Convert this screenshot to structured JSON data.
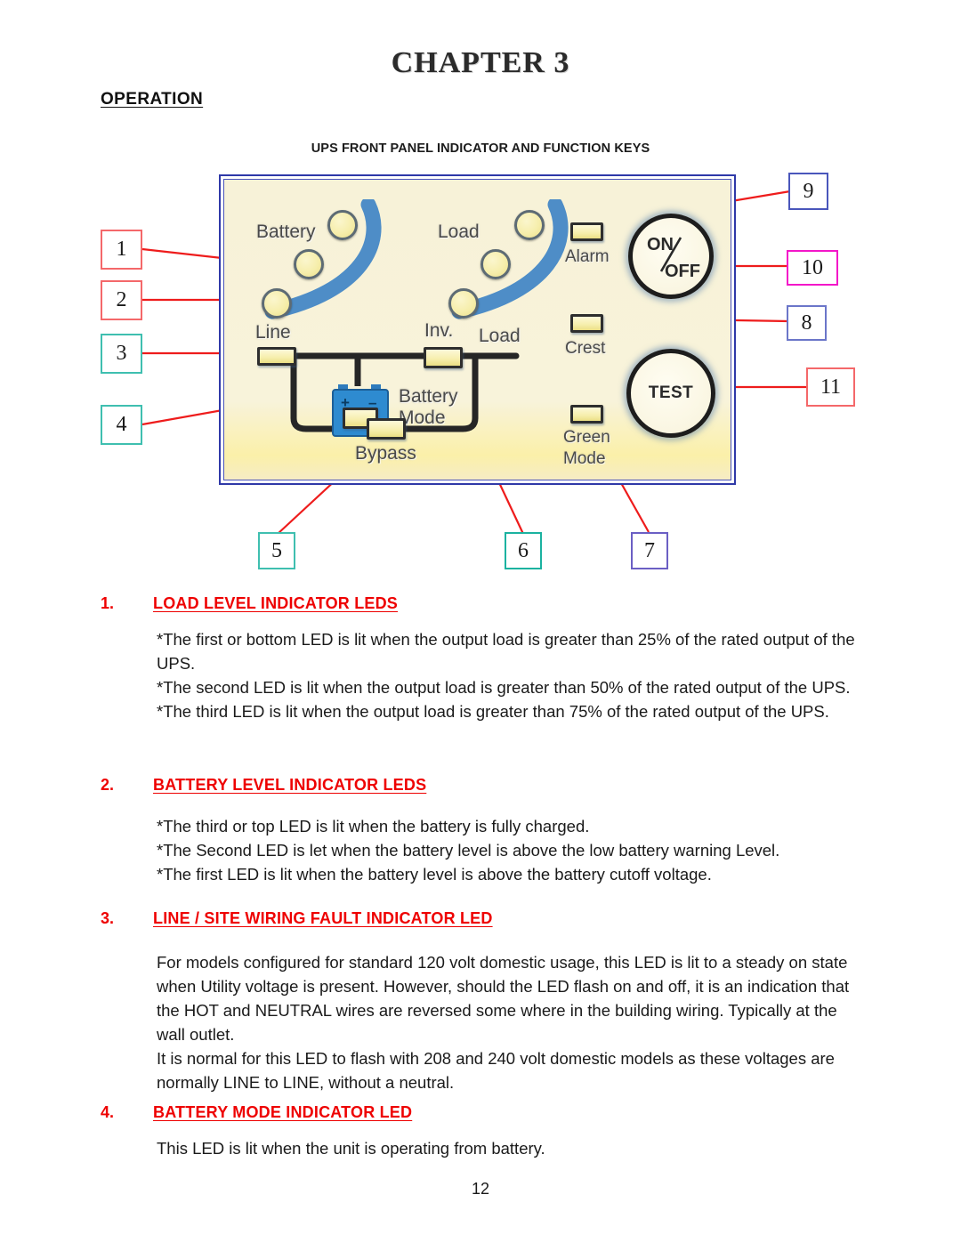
{
  "header": {
    "chapter_title": "CHAPTER 3",
    "operation_heading": "OPERATION",
    "figure_caption": "UPS FRONT PANEL INDICATOR AND FUNCTION KEYS"
  },
  "panel": {
    "labels": {
      "battery": "Battery",
      "load_top": "Load",
      "alarm": "Alarm",
      "crest": "Crest",
      "green_mode_1": "Green",
      "green_mode_2": "Mode",
      "line": "Line",
      "inv": "Inv.",
      "load_right": "Load",
      "battery_mode_1": "Battery",
      "battery_mode_2": "Mode",
      "bypass": "Bypass"
    },
    "buttons": {
      "on_off_top": "ON",
      "on_off_bottom": "OFF",
      "test": "TEST"
    },
    "battery_symbol": {
      "plus": "+",
      "minus": "–"
    }
  },
  "callouts": [
    {
      "id": "1",
      "label": "1",
      "color": "#f4686a"
    },
    {
      "id": "2",
      "label": "2",
      "color": "#f4686a"
    },
    {
      "id": "3",
      "label": "3",
      "color": "#3fbfb0"
    },
    {
      "id": "4",
      "label": "4",
      "color": "#3fbfb0"
    },
    {
      "id": "5",
      "label": "5",
      "color": "#3fbfb0"
    },
    {
      "id": "6",
      "label": "6",
      "color": "#1bb2a0"
    },
    {
      "id": "7",
      "label": "7",
      "color": "#6b5fc4"
    },
    {
      "id": "8",
      "label": "8",
      "color": "#6b76c9"
    },
    {
      "id": "9",
      "label": "9",
      "color": "#4a56bb"
    },
    {
      "id": "10",
      "label": "10",
      "color": "#f317c9"
    },
    {
      "id": "11",
      "label": "11",
      "color": "#f4686a"
    }
  ],
  "sections": [
    {
      "number": "1.",
      "title": "LOAD LEVEL INDICATOR LEDS",
      "body": "*The first or bottom LED is lit when the output load is greater than 25% of the rated output of the UPS.\n*The second LED is lit when the output load is greater than 50% of the rated output of the UPS.\n*The third LED is lit when the output load is greater than 75% of the rated output of the UPS."
    },
    {
      "number": "2.",
      "title": "BATTERY LEVEL INDICATOR LEDS",
      "body": "*The third or top LED is lit when the battery is fully charged.\n*The Second LED is let when the battery level is above the low battery warning Level.\n*The first LED is lit when the battery level is above the battery cutoff voltage."
    },
    {
      "number": "3.",
      "title": "LINE / SITE WIRING FAULT INDICATOR LED",
      "body": "For models configured for standard 120 volt domestic usage, this LED is lit to a steady on state when Utility voltage is present. However, should the LED flash on and off, it is an indication that the HOT and NEUTRAL wires are reversed some where in the building wiring. Typically at the wall outlet.\nIt is normal for this LED to flash with 208 and 240 volt domestic models as these voltages are normally LINE to LINE, without a neutral."
    },
    {
      "number": "4.",
      "title": "BATTERY MODE INDICATOR LED",
      "body": "This LED is lit when the unit is operating from battery."
    }
  ],
  "footer": {
    "page_number": "12"
  },
  "colors": {
    "heading_red": "#ee0000",
    "panel_border_blue": "#2f39a8",
    "panel_face": "#f7f2d8",
    "led_yellow": "#f6eeac",
    "leader_red": "#ee1c1c",
    "swoosh_blue": "#3f84c6"
  }
}
